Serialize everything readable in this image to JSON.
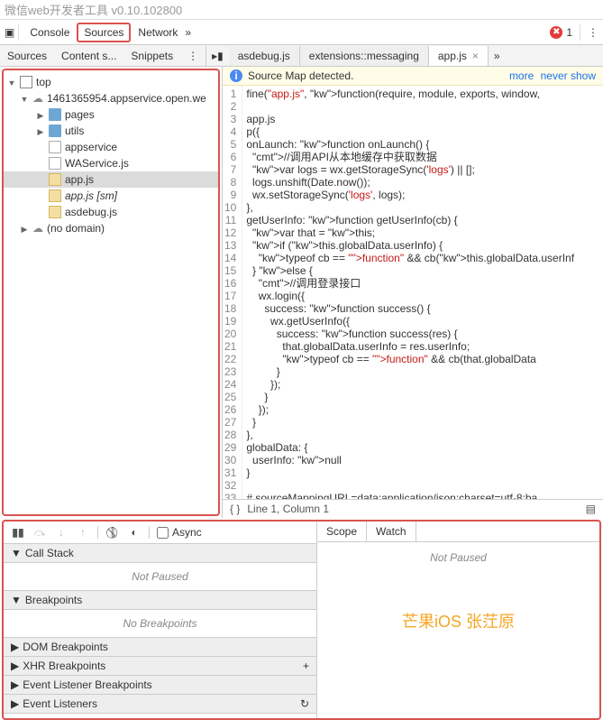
{
  "title": "微信web开发者工具 v0.10.102800",
  "mainTabs": {
    "console": "Console",
    "sources": "Sources",
    "network": "Network"
  },
  "errors": "1",
  "subTabs": {
    "sources": "Sources",
    "contentScripts": "Content s...",
    "snippets": "Snippets"
  },
  "fileTabs": {
    "asdebug": "asdebug.js",
    "messaging": "extensions::messaging",
    "app": "app.js"
  },
  "infoBar": {
    "msg": "Source Map detected.",
    "more": "more",
    "never": "never show"
  },
  "tree": {
    "top": "top",
    "domain": "1461365954.appservice.open.we",
    "pages": "pages",
    "utils": "utils",
    "appservice": "appservice",
    "waservice": "WAService.js",
    "appjs": "app.js",
    "appjssm": "app.js [sm]",
    "asdebug": "asdebug.js",
    "nodomain": "(no domain)"
  },
  "code": {
    "lines": [
      "fine(\"app.js\", function(require, module, exports, window,",
      "",
      "app.js",
      "p({",
      "onLaunch: function onLaunch() {",
      "  //调用API从本地缓存中获取数据",
      "  var logs = wx.getStorageSync('logs') || [];",
      "  logs.unshift(Date.now());",
      "  wx.setStorageSync('logs', logs);",
      "},",
      "getUserInfo: function getUserInfo(cb) {",
      "  var that = this;",
      "  if (this.globalData.userInfo) {",
      "    typeof cb == \"function\" && cb(this.globalData.userInf",
      "  } else {",
      "    //调用登录接口",
      "    wx.login({",
      "      success: function success() {",
      "        wx.getUserInfo({",
      "          success: function success(res) {",
      "            that.globalData.userInfo = res.userInfo;",
      "            typeof cb == \"function\" && cb(that.globalData",
      "          }",
      "        });",
      "      }",
      "    });",
      "  }",
      "},",
      "globalData: {",
      "  userInfo: null",
      "}",
      "",
      "# sourceMappingURL=data:application/json;charset=utf-8;ba"
    ]
  },
  "editorStatus": "Line 1, Column 1",
  "async": "Async",
  "sections": {
    "callstack": "Call Stack",
    "notPaused": "Not Paused",
    "breakpoints": "Breakpoints",
    "noBreakpoints": "No Breakpoints",
    "domBreakpoints": "DOM Breakpoints",
    "xhrBreakpoints": "XHR Breakpoints",
    "eventListenerBp": "Event Listener Breakpoints",
    "eventListeners": "Event Listeners"
  },
  "scopeTabs": {
    "scope": "Scope",
    "watch": "Watch"
  },
  "scopeBody": {
    "notPaused": "Not Paused",
    "watermark": "芒果iOS 张茳原"
  }
}
